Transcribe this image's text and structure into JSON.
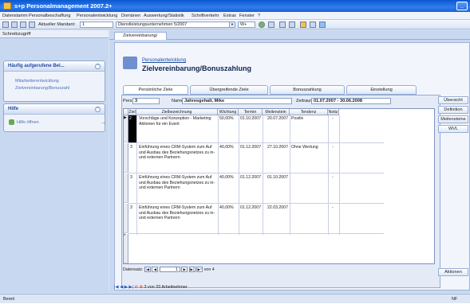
{
  "window": {
    "title": "s+p Personalmanagement 2007.2+"
  },
  "menu": [
    "Datenstamm",
    "Personalbeschaffung",
    "Personalentwicklung",
    "Domänen",
    "Auswertung/Statistik",
    "Schriftverkehr",
    "Extras",
    "Fenster",
    "?"
  ],
  "toolbar": {
    "mandant_label": "Aktueller Mandant:",
    "mandant_value": "1",
    "company_value": "Dienstleistungsunternehmen 5/2007",
    "w_value": "W+"
  },
  "left": {
    "header": "Schreibzugriff",
    "box1_title": "Häufig aufgerufene Bel...",
    "box1_items": [
      "Mitarbeiterentwicklung",
      "Zielvereinbarung/Bonuszahl"
    ],
    "box2_title": "Hilfe",
    "box2_items": [
      "Hilfe öffnen"
    ]
  },
  "doc_tab": "Zielvereinbarung/",
  "page": {
    "breadcrumb": "Personalentwicklung",
    "title": "Zielvereinbarung/Bonuszahlung"
  },
  "subtabs": [
    "Persönliche Ziele",
    "Übergreifende Ziele",
    "Bonuszahlung",
    "Einstellung"
  ],
  "filters": {
    "persnr_label": "PersNr",
    "persnr_value": "3",
    "name_label": "Name",
    "name_value": "Jahresgehalt, Mike",
    "zeitraum_label": "Zeitraum",
    "zeitraum_value": "01.07.2007 - 30.06.2008"
  },
  "grid": {
    "columns": [
      "Ziel",
      "Zielbezeichnung",
      "Wichtung",
      "Termin",
      "Meilenstein",
      "Tendenz",
      "Notiz"
    ],
    "rows": [
      {
        "ziel": "2",
        "bez": "Vorschläge und Konzeption - Marketing Aktionen für ein Event",
        "wichtung": "50,00%",
        "termin": "01.10.2007",
        "meilenstein": "20.07.2007",
        "tendenz": "Positiv",
        "notiz": "-"
      },
      {
        "ziel": "3",
        "bez": "Einführung eines CRM-System zum Auf und Ausbau des Beziehungsnetzes zu in- und externen Partnern",
        "wichtung": "40,00%",
        "termin": "01.12.2007",
        "meilenstein": "27.10.2007",
        "tendenz": "Ohne Wertung",
        "notiz": "-"
      },
      {
        "ziel": "3",
        "bez": "Einführung eines CRM-System zum Auf und Ausbau des Beziehungsnetzes zu in- und externen Partnern",
        "wichtung": "40,00%",
        "termin": "01.12.2007",
        "meilenstein": "01.10.2007",
        "tendenz": "",
        "notiz": "-"
      },
      {
        "ziel": "3",
        "bez": "Einführung eines CRM-System zum Auf und Ausbau des Beziehungsnetzes zu in- und externen Partnern",
        "wichtung": "40,00%",
        "termin": "01.12.2007",
        "meilenstein": "22.03.2007",
        "tendenz": "",
        "notiz": "-"
      }
    ],
    "new_row_marker": "*"
  },
  "record_nav": {
    "label": "Datensatz:",
    "current": "1",
    "total_text": "von 4"
  },
  "right_buttons": [
    "Übersicht",
    "Definition",
    "Meilensteine",
    "WVL"
  ],
  "aktionen_button": "Aktionen",
  "status_nav_text": "3 von 33 Arbeitnehmer",
  "statusbar": {
    "left": "Bereit",
    "right": "NF"
  }
}
